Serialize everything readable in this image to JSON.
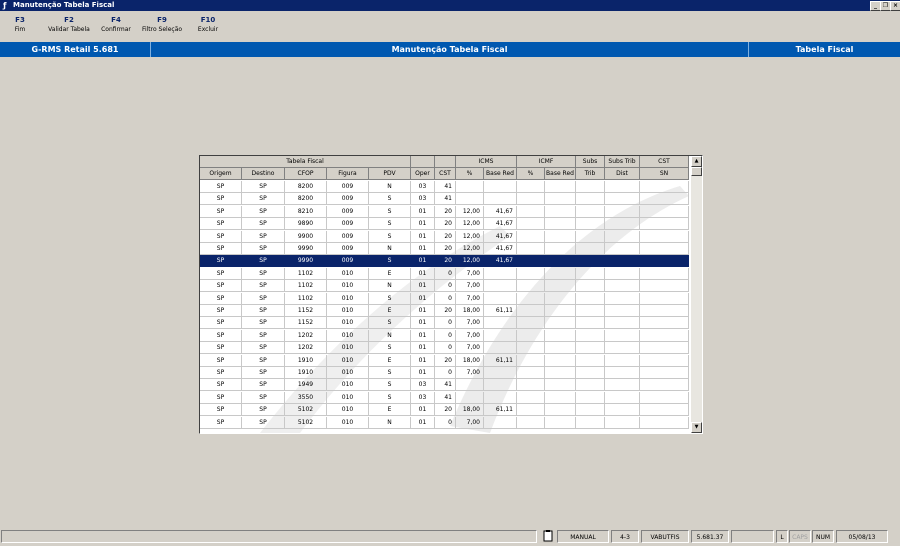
{
  "window": {
    "title": "Manutenção Tabela Fiscal",
    "app_icon": "app-icon",
    "buttons": [
      "minimize",
      "restore",
      "close"
    ]
  },
  "toolbar": [
    {
      "key": "F3",
      "label": "Fim"
    },
    {
      "key": "F2",
      "label": "Validar Tabela"
    },
    {
      "key": "F4",
      "label": "Confirmar"
    },
    {
      "key": "F9",
      "label": "Filtro Seleção"
    },
    {
      "key": "F10",
      "label": "Excluir"
    }
  ],
  "header": {
    "left": "G-RMS Retail 5.681",
    "center": "Manutenção Tabela Fiscal",
    "right": "Tabela Fiscal"
  },
  "table": {
    "group_headers": {
      "tabela_fiscal": "Tabela Fiscal",
      "icms": "ICMS",
      "icmf": "ICMF",
      "subs": "Subs",
      "subs_trib": "Subs Trib",
      "cst": "CST"
    },
    "columns": [
      "Origem",
      "Destino",
      "CFOP",
      "Figura",
      "PDV",
      "Oper",
      "CST",
      "%",
      "Base Red",
      "%",
      "Base Red",
      "Trib",
      "Dist",
      "SN"
    ],
    "selected_row": 6,
    "rows": [
      [
        "SP",
        "SP",
        "8200",
        "009",
        "N",
        "03",
        "41",
        "",
        "",
        "",
        "",
        "",
        "",
        ""
      ],
      [
        "SP",
        "SP",
        "8200",
        "009",
        "S",
        "03",
        "41",
        "",
        "",
        "",
        "",
        "",
        "",
        ""
      ],
      [
        "SP",
        "SP",
        "8210",
        "009",
        "S",
        "01",
        "20",
        "12,00",
        "41,67",
        "",
        "",
        "",
        "",
        ""
      ],
      [
        "SP",
        "SP",
        "9890",
        "009",
        "S",
        "01",
        "20",
        "12,00",
        "41,67",
        "",
        "",
        "",
        "",
        ""
      ],
      [
        "SP",
        "SP",
        "9900",
        "009",
        "S",
        "01",
        "20",
        "12,00",
        "41,67",
        "",
        "",
        "",
        "",
        ""
      ],
      [
        "SP",
        "SP",
        "9990",
        "009",
        "N",
        "01",
        "20",
        "12,00",
        "41,67",
        "",
        "",
        "",
        "",
        ""
      ],
      [
        "SP",
        "SP",
        "9990",
        "009",
        "S",
        "01",
        "20",
        "12,00",
        "41,67",
        "",
        "",
        "",
        "",
        ""
      ],
      [
        "SP",
        "SP",
        "1102",
        "010",
        "E",
        "01",
        "0",
        "7,00",
        "",
        "",
        "",
        "",
        "",
        ""
      ],
      [
        "SP",
        "SP",
        "1102",
        "010",
        "N",
        "01",
        "0",
        "7,00",
        "",
        "",
        "",
        "",
        "",
        ""
      ],
      [
        "SP",
        "SP",
        "1102",
        "010",
        "S",
        "01",
        "0",
        "7,00",
        "",
        "",
        "",
        "",
        "",
        ""
      ],
      [
        "SP",
        "SP",
        "1152",
        "010",
        "E",
        "01",
        "20",
        "18,00",
        "61,11",
        "",
        "",
        "",
        "",
        ""
      ],
      [
        "SP",
        "SP",
        "1152",
        "010",
        "S",
        "01",
        "0",
        "7,00",
        "",
        "",
        "",
        "",
        "",
        ""
      ],
      [
        "SP",
        "SP",
        "1202",
        "010",
        "N",
        "01",
        "0",
        "7,00",
        "",
        "",
        "",
        "",
        "",
        ""
      ],
      [
        "SP",
        "SP",
        "1202",
        "010",
        "S",
        "01",
        "0",
        "7,00",
        "",
        "",
        "",
        "",
        "",
        ""
      ],
      [
        "SP",
        "SP",
        "1910",
        "010",
        "E",
        "01",
        "20",
        "18,00",
        "61,11",
        "",
        "",
        "",
        "",
        ""
      ],
      [
        "SP",
        "SP",
        "1910",
        "010",
        "S",
        "01",
        "0",
        "7,00",
        "",
        "",
        "",
        "",
        "",
        ""
      ],
      [
        "SP",
        "SP",
        "1949",
        "010",
        "S",
        "03",
        "41",
        "",
        "",
        "",
        "",
        "",
        "",
        ""
      ],
      [
        "SP",
        "SP",
        "3550",
        "010",
        "S",
        "03",
        "41",
        "",
        "",
        "",
        "",
        "",
        "",
        ""
      ],
      [
        "SP",
        "SP",
        "5102",
        "010",
        "E",
        "01",
        "20",
        "18,00",
        "61,11",
        "",
        "",
        "",
        "",
        ""
      ],
      [
        "SP",
        "SP",
        "5102",
        "010",
        "N",
        "01",
        "0",
        "7,00",
        "",
        "",
        "",
        "",
        "",
        ""
      ]
    ]
  },
  "statusbar": {
    "mode": "MANUAL",
    "page": "4-3",
    "user": "VABUTFIS",
    "version": "5.681.37",
    "l": "L",
    "caps": "CAPS",
    "num": "NUM",
    "date": "05/08/13"
  }
}
